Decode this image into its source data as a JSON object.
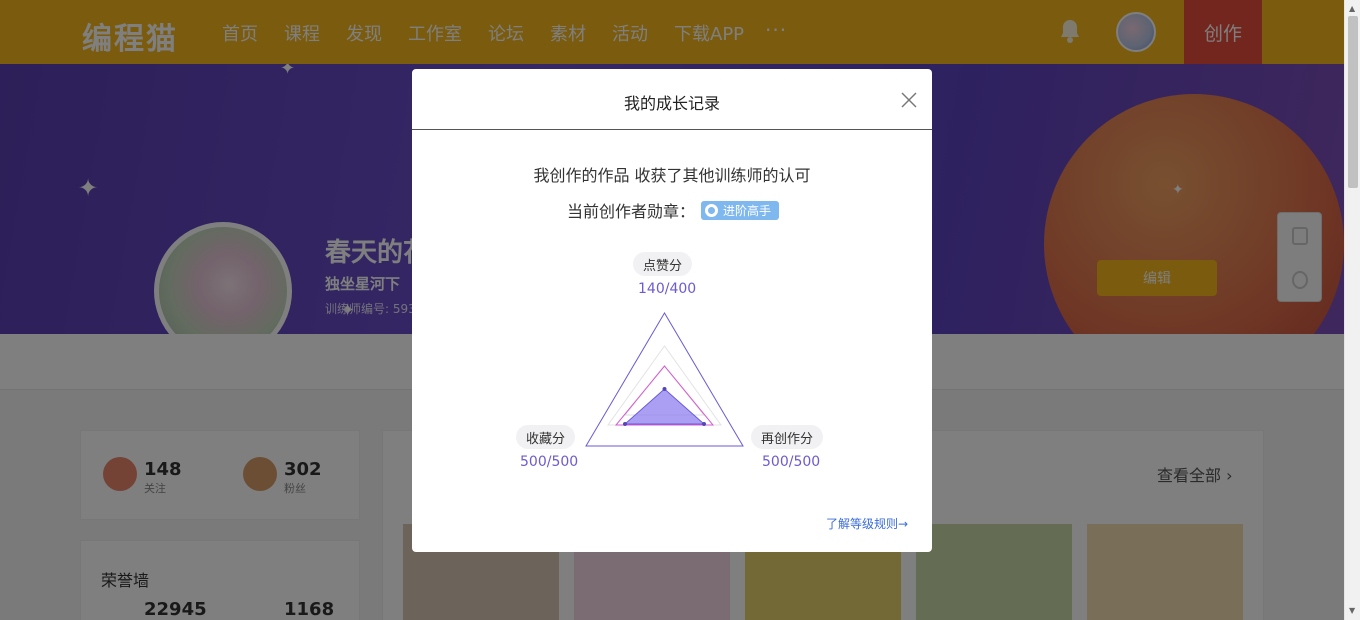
{
  "nav": {
    "logo": "编程猫",
    "items": [
      "首页",
      "课程",
      "发现",
      "工作室",
      "论坛",
      "素材",
      "活动",
      "下载APP"
    ],
    "more": "···",
    "create": "创作"
  },
  "profile": {
    "name_visible": "春天的花",
    "subtitle": "独坐星河下",
    "id_text": "训练师编号: 593",
    "edit_label": "编辑"
  },
  "stats": {
    "follow_count": "148",
    "follow_label": "关注",
    "fans_count": "302",
    "fans_label": "粉丝"
  },
  "honor": {
    "title": "荣誉墙",
    "value1": "22945",
    "value2": "1168"
  },
  "works": {
    "view_all": "查看全部"
  },
  "modal": {
    "title": "我的成长记录",
    "headline": "我创作的作品 收获了其他训练师的认可",
    "badge_prefix": "当前创作者勋章：",
    "badge_label": "进阶高手",
    "axes": [
      {
        "label": "点赞分",
        "score": "140/400"
      },
      {
        "label": "收藏分",
        "score": "500/500"
      },
      {
        "label": "再创作分",
        "score": "500/500"
      }
    ],
    "rules_link": "了解等级规则→"
  },
  "colors": {
    "nav_bg": "#f6b61a",
    "create_bg": "#e64c3c",
    "score_color": "#6d5bd0",
    "badge_bg": "#7fb7ef"
  }
}
